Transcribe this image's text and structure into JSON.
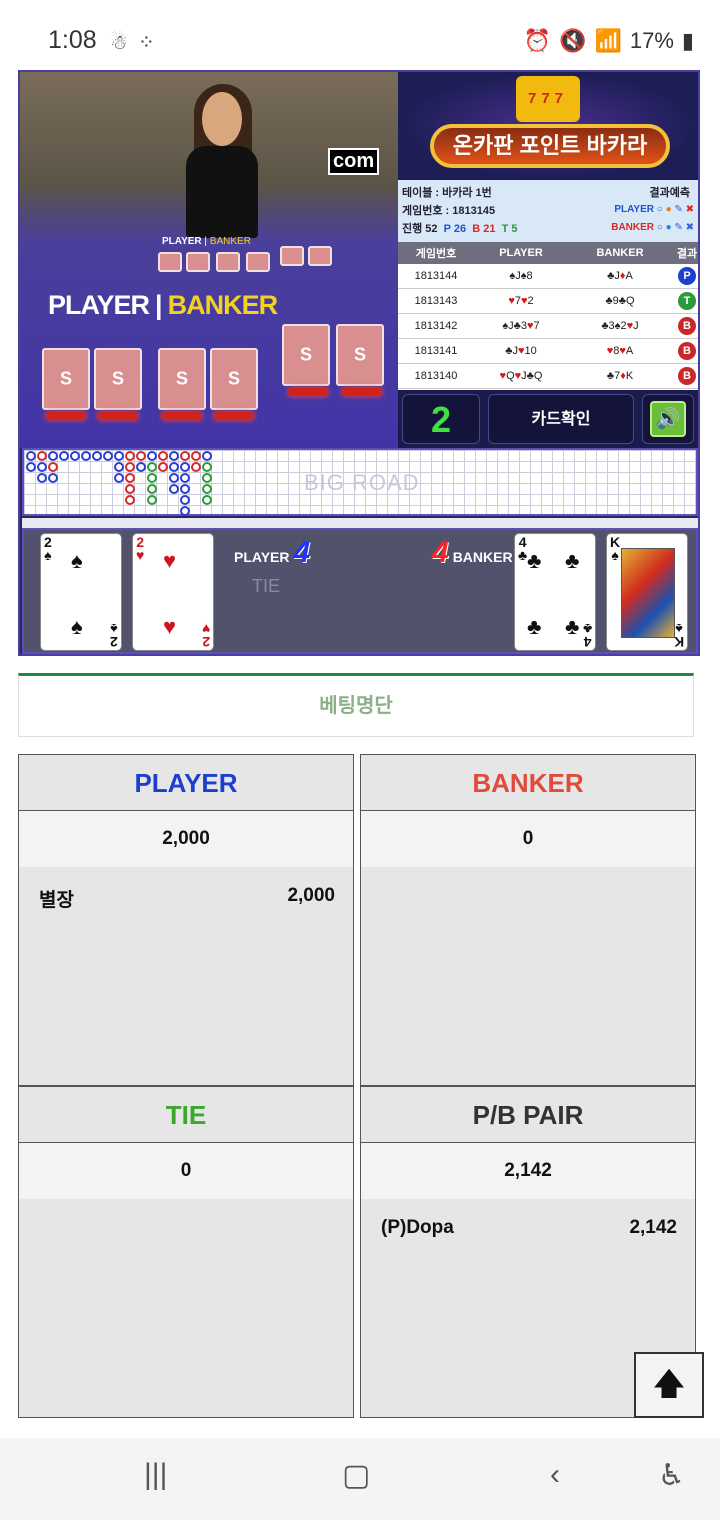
{
  "status": {
    "time": "1:08",
    "battery": "17%"
  },
  "video": {
    "watermark": "com",
    "table_label_player": "PLAYER",
    "table_label_banker": "BANKER",
    "small_player": "PLAYER",
    "small_banker": "BANKER",
    "card_brand": "S"
  },
  "banner": {
    "title": "온카판 포인트 바카라",
    "slot": "777"
  },
  "info": {
    "table": "테이블 : 바카라 1번",
    "game_no": "게임번호 : 1813145",
    "progress": "진행 52",
    "p_count": "P 26",
    "b_count": "B 21",
    "t_count": "T 5",
    "prediction_title": "결과예측",
    "pred_player": "PLAYER",
    "pred_banker": "BANKER"
  },
  "history": {
    "headers": [
      "게임번호",
      "PLAYER",
      "BANKER",
      "결과"
    ],
    "rows": [
      {
        "game": "1813144",
        "player": "♠J♠8",
        "banker": "♣J♦A",
        "result": "P"
      },
      {
        "game": "1813143",
        "player": "♥7♥2",
        "banker": "♣9♣Q",
        "result": "T"
      },
      {
        "game": "1813142",
        "player": "♠J♣3♥7",
        "banker": "♣3♠2♥J",
        "result": "B"
      },
      {
        "game": "1813141",
        "player": "♣J♥10",
        "banker": "♥8♥A",
        "result": "B"
      },
      {
        "game": "1813140",
        "player": "♥Q♥J♣Q",
        "banker": "♣7♦K",
        "result": "B"
      }
    ]
  },
  "controls": {
    "count": "2",
    "card_confirm": "카드확인"
  },
  "bigroad": {
    "title": "BIG ROAD"
  },
  "round": {
    "player_label": "PLAYER",
    "player_score": "4",
    "banker_label": "BANKER",
    "banker_score": "4",
    "tie_ghost": "TIE",
    "player_cards": [
      {
        "rank": "2",
        "suit": "♠",
        "color": "#111111"
      },
      {
        "rank": "2",
        "suit": "♥",
        "color": "#d0161d"
      }
    ],
    "banker_cards": [
      {
        "rank": "4",
        "suit": "♣",
        "color": "#111111"
      },
      {
        "rank": "K",
        "suit": "♠",
        "color": "#111111"
      }
    ]
  },
  "bet_list_title": "베팅명단",
  "panels": {
    "player": {
      "title": "PLAYER",
      "color": "#1c3fd0",
      "total": "2,000",
      "entries": [
        {
          "name": "별장",
          "amount": "2,000"
        }
      ]
    },
    "banker": {
      "title": "BANKER",
      "color": "#e04b3c",
      "total": "0",
      "entries": []
    },
    "tie": {
      "title": "TIE",
      "color": "#3aa82a",
      "total": "0",
      "entries": []
    },
    "pair": {
      "title": "P/B PAIR",
      "color": "#333333",
      "total": "2,142",
      "entries": [
        {
          "name": "(P)Dopa",
          "amount": "2,142"
        }
      ]
    }
  },
  "icons": {
    "to_top": "arrow-up-icon",
    "nav_recent": "recent-apps-icon",
    "nav_home": "home-icon",
    "nav_back": "back-icon",
    "nav_access": "accessibility-icon"
  }
}
